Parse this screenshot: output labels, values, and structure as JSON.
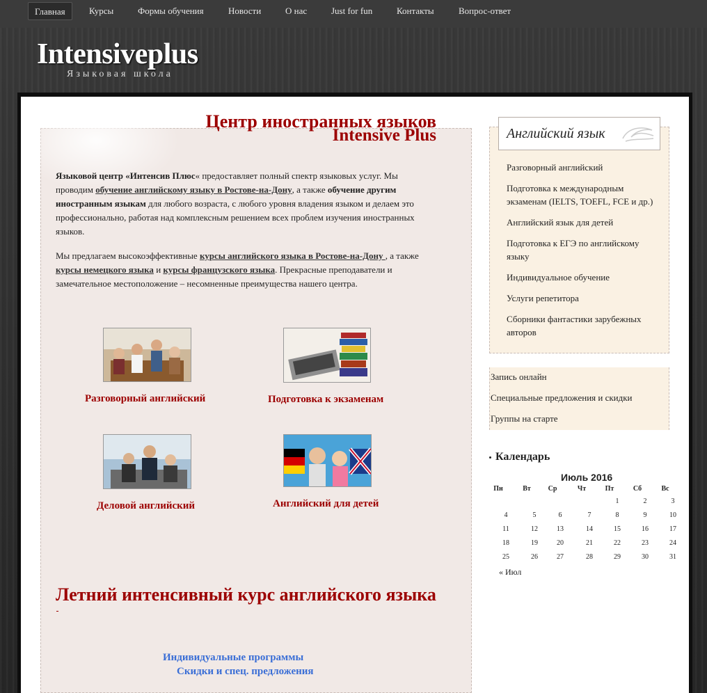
{
  "nav": {
    "items": [
      "Главная",
      "Курсы",
      "Формы обучения",
      "Новости",
      "О нас",
      "Just for fun",
      "Контакты",
      "Вопрос-ответ"
    ]
  },
  "site": {
    "logo": "Intensiveplus",
    "tagline": "Языковая школа"
  },
  "main": {
    "title_line1": "Центр иностранных языков",
    "title_line2": "Intensive Plus",
    "p1": {
      "b1": "Языковой центр «Интенсив Плюс",
      "t1": "« предоставляет полный спектр языковых услуг. Мы проводим ",
      "a1": "обучение английскому языку в Ростове-на-Дону",
      "t2": ", а также ",
      "b2": "обучение другим иностранным языкам",
      "t3": " для любого возраста, с любого уровня владения языком и делаем это профессионально, работая над комплексным решением всех проблем изучения иностранных языков."
    },
    "p2": {
      "t1": "Мы предлагаем высокоэффективные ",
      "a1": "курсы английского языка в  Ростове-на-Дону ",
      "t2": ", а также ",
      "a2": "курсы немецкого языка",
      "t3": " и ",
      "a3": "курсы французского языка",
      "t4": ". Прекрасные преподаватели и замечательное местоположение – несомненные преимущества нашего центра."
    },
    "captions": [
      "Разговорный английский",
      "Подготовка к экзаменам",
      "Деловой английский",
      "Английский для детей"
    ],
    "summer": "Летний интенсивный курс английского языка",
    "blue1": "Индивидуальные программы",
    "blue2": "Скидки и спец.  предложения"
  },
  "sidebar": {
    "heading": "Английский язык",
    "links": [
      "Разговорный английский",
      "Подготовка к международным экзаменам (IELTS, TOEFL, FCE и др.)",
      "Английский язык для детей",
      "Подготовка к ЕГЭ по английскому языку",
      "Индивидуальное обучение",
      "Услуги репетитора",
      "Сборники фантастики зарубежных авторов"
    ],
    "links2": [
      "Запись онлайн",
      "Специальные предложения и скидки",
      "Группы на старте"
    ]
  },
  "calendar": {
    "heading": "Календарь",
    "caption": "Июль 2016",
    "weekdays": [
      "Пн",
      "Вт",
      "Ср",
      "Чт",
      "Пт",
      "Сб",
      "Вс"
    ],
    "weeks": [
      [
        "",
        "",
        "",
        "",
        "1",
        "2",
        "3"
      ],
      [
        "4",
        "5",
        "6",
        "7",
        "8",
        "9",
        "10"
      ],
      [
        "11",
        "12",
        "13",
        "14",
        "15",
        "16",
        "17"
      ],
      [
        "18",
        "19",
        "20",
        "21",
        "22",
        "23",
        "24"
      ],
      [
        "25",
        "26",
        "27",
        "28",
        "29",
        "30",
        "31"
      ]
    ],
    "prev": "« Июл"
  },
  "colors": {
    "accent": "#9c0000",
    "link_blue": "#3a6ed6",
    "box": "#f1e9e6",
    "sidebox": "#faf1e3"
  }
}
